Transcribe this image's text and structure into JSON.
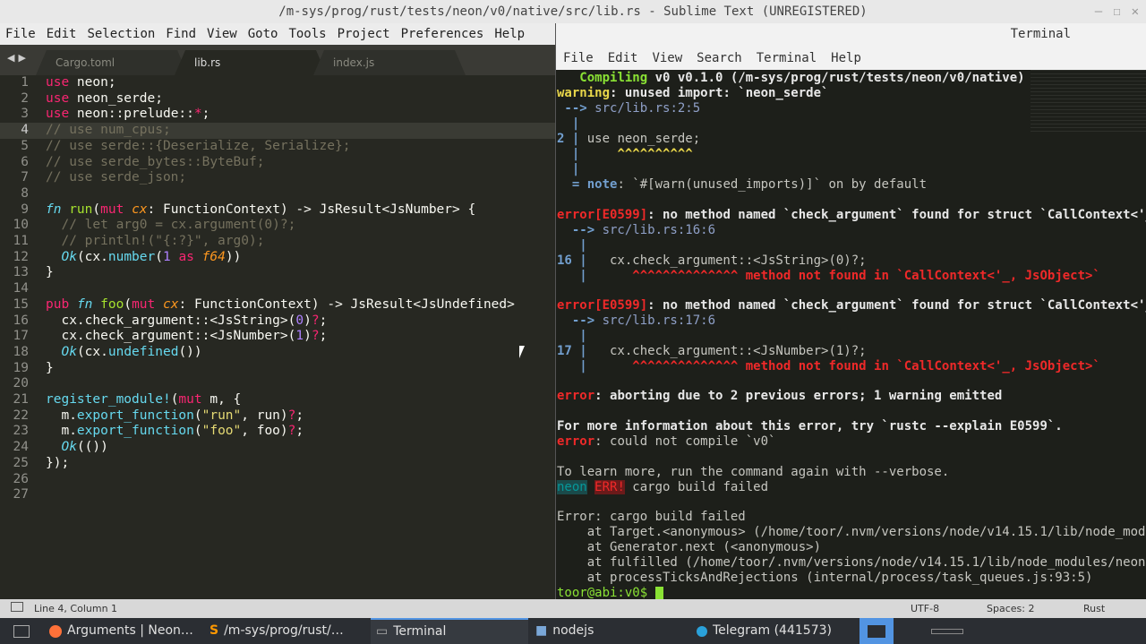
{
  "sublime": {
    "title": "/m-sys/prog/rust/tests/neon/v0/native/src/lib.rs - Sublime Text (UNREGISTERED)",
    "menu": [
      "File",
      "Edit",
      "Selection",
      "Find",
      "View",
      "Goto",
      "Tools",
      "Project",
      "Preferences",
      "Help"
    ],
    "tabs": [
      "Cargo.toml",
      "lib.rs",
      "index.js"
    ],
    "status": {
      "position": "Line 4, Column 1",
      "encoding": "UTF-8",
      "indent": "Spaces: 2",
      "syntax": "Rust"
    }
  },
  "terminal": {
    "title": "Terminal",
    "menu": [
      "File",
      "Edit",
      "View",
      "Search",
      "Terminal",
      "Help"
    ],
    "lines": {
      "l0": "Compiling",
      "l0b": " v0 v0.1.0 (/m-sys/prog/rust/tests/neon/v0/native)",
      "w1": "warning",
      "w1b": ": unused import: `neon_serde`",
      "arrow1": " --> ",
      "loc1": "src/lib.rs:2:5",
      "n2": "2",
      "use_line": " use neon_serde;",
      "caret1": "^^^^^^^^^^",
      "note": "= note",
      "note_text": ": `#[warn(unused_imports)]` on by default",
      "err1": "error[E0599]",
      "err1_text": ": no method named `check_argument` found for struct `CallContext<'_",
      "loc2": "src/lib.rs:16:6",
      "n16": "16",
      "code16": "   cx.check_argument::<JsString>(0)?;",
      "caret2": "^^^^^^^^^^^^^^",
      "mnf": " method not found in `CallContext<'_, JsObject>`",
      "err2": "error[E0599]",
      "err2_text": ": no method named `check_argument` found for struct `CallContext<'_",
      "loc3": "src/lib.rs:17:6",
      "n17": "17",
      "code17": "   cx.check_argument::<JsNumber>(1)?;",
      "caret3": "^^^^^^^^^^^^^^",
      "mnf2": " method not found in `CallContext<'_, JsObject>`",
      "err3": "error",
      "err3_text": ": aborting due to 2 previous errors; 1 warning emitted",
      "more_info": "For more information about this error, try `rustc --explain E0599`.",
      "err4": "error",
      "err4_text": ": could not compile `v0`",
      "learn": "To learn more, run the command again with --verbose.",
      "neon": "neon",
      "errtag": "ERR!",
      "build_failed": " cargo build failed",
      "e1": "Error: cargo build failed",
      "e2": "    at Target.<anonymous> (/home/toor/.nvm/versions/node/v14.15.1/lib/node_mod",
      "e3": "    at Generator.next (<anonymous>)",
      "e4": "    at fulfilled (/home/toor/.nvm/versions/node/v14.15.1/lib/node_modules/neon",
      "e5": "    at processTicksAndRejections (internal/process/task_queues.js:93:5)",
      "prompt": "toor@abi:v0$ "
    }
  },
  "taskbar": {
    "items": [
      "Arguments | Neon…",
      "/m-sys/prog/rust/…",
      "Terminal",
      "nodejs",
      "Telegram (441573)"
    ]
  }
}
